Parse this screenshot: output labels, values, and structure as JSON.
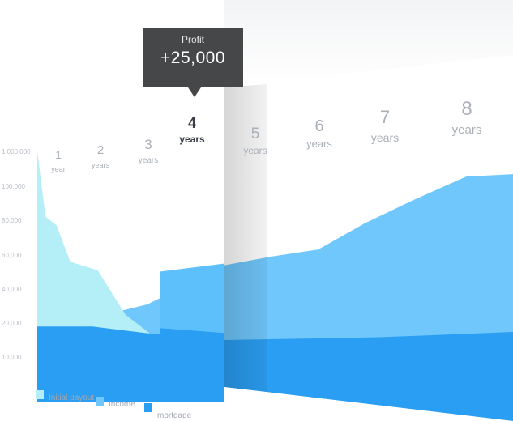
{
  "chart_data": {
    "type": "area",
    "y_ticks": [
      "1,000,000",
      "100,000",
      "80,000",
      "60,000",
      "40,000",
      "20,000",
      "10,000"
    ],
    "years": [
      {
        "num": "1",
        "label": "year"
      },
      {
        "num": "2",
        "label": "years"
      },
      {
        "num": "3",
        "label": "years"
      },
      {
        "num": "4",
        "label": "years"
      },
      {
        "num": "5",
        "label": "years"
      },
      {
        "num": "6",
        "label": "years"
      },
      {
        "num": "7",
        "label": "years"
      },
      {
        "num": "8",
        "label": "years"
      }
    ],
    "active_year_index": 3,
    "series": [
      {
        "name": "Initial payout",
        "color": "#b4eef6",
        "points": [
          [
            0,
            1000000
          ],
          [
            0.15,
            82000
          ],
          [
            0.35,
            77000
          ],
          [
            0.6,
            56000
          ],
          [
            1.1,
            51000
          ],
          [
            1.6,
            25000
          ],
          [
            2.2,
            15000
          ],
          [
            2.6,
            13000
          ],
          [
            3.0,
            16000
          ],
          [
            3.4,
            18000
          ]
        ]
      },
      {
        "name": "Income",
        "color": "#6fc7fb",
        "points": [
          [
            0,
            24000
          ],
          [
            0.5,
            25000
          ],
          [
            1.0,
            26000
          ],
          [
            1.5,
            27000
          ],
          [
            2.0,
            31000
          ],
          [
            2.5,
            39000
          ],
          [
            3.0,
            47000
          ],
          [
            3.4,
            52000
          ],
          [
            4.0,
            54000
          ],
          [
            4.6,
            58000
          ],
          [
            5.2,
            61000
          ],
          [
            5.8,
            75000
          ],
          [
            6.4,
            87000
          ],
          [
            7.1,
            100000
          ],
          [
            7.7,
            113000
          ]
        ]
      },
      {
        "name": "mortgage",
        "color": "#2a9ef2",
        "points": [
          [
            0,
            19000
          ],
          [
            1.0,
            19000
          ],
          [
            2.0,
            17000
          ],
          [
            3.0,
            16000
          ],
          [
            4.0,
            15000
          ],
          [
            5.0,
            14500
          ],
          [
            6.0,
            14000
          ],
          [
            7.7,
            14000
          ]
        ]
      }
    ],
    "legend_placement": "bottom-left"
  },
  "tooltip": {
    "label": "Profit",
    "value": "+25,000"
  }
}
